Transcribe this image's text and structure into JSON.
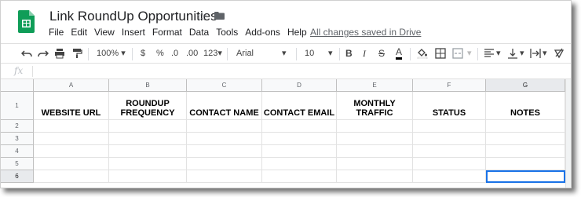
{
  "app": {
    "title": "Link RoundUp Opportunities",
    "saved_status": "All changes saved in Drive",
    "logo_icon": "google-sheets-icon",
    "accent_color": "#0f9d58"
  },
  "menu": [
    "File",
    "Edit",
    "View",
    "Insert",
    "Format",
    "Data",
    "Tools",
    "Add-ons",
    "Help"
  ],
  "toolbar": {
    "zoom": "100%",
    "currency": "$",
    "percent": "%",
    "decrease_decimal": ".0",
    "increase_decimal": ".00",
    "more_formats": "123",
    "font": "Arial",
    "font_size": "10",
    "bold": "B",
    "italic": "I",
    "strikethrough": "S",
    "text_color": "A"
  },
  "formula_bar": {
    "fx": "fx"
  },
  "sheet": {
    "columns": [
      "A",
      "B",
      "C",
      "D",
      "E",
      "F",
      "G"
    ],
    "rows": [
      "1",
      "2",
      "3",
      "4",
      "5",
      "6"
    ],
    "headers": [
      "WEBSITE URL",
      "ROUNDUP FREQUENCY",
      "CONTACT NAME",
      "CONTACT EMAIL",
      "MONTHLY TRAFFIC",
      "STATUS",
      "NOTES"
    ],
    "selected_column": "G",
    "selected_row": "6",
    "selection_color": "#1a73e8"
  }
}
